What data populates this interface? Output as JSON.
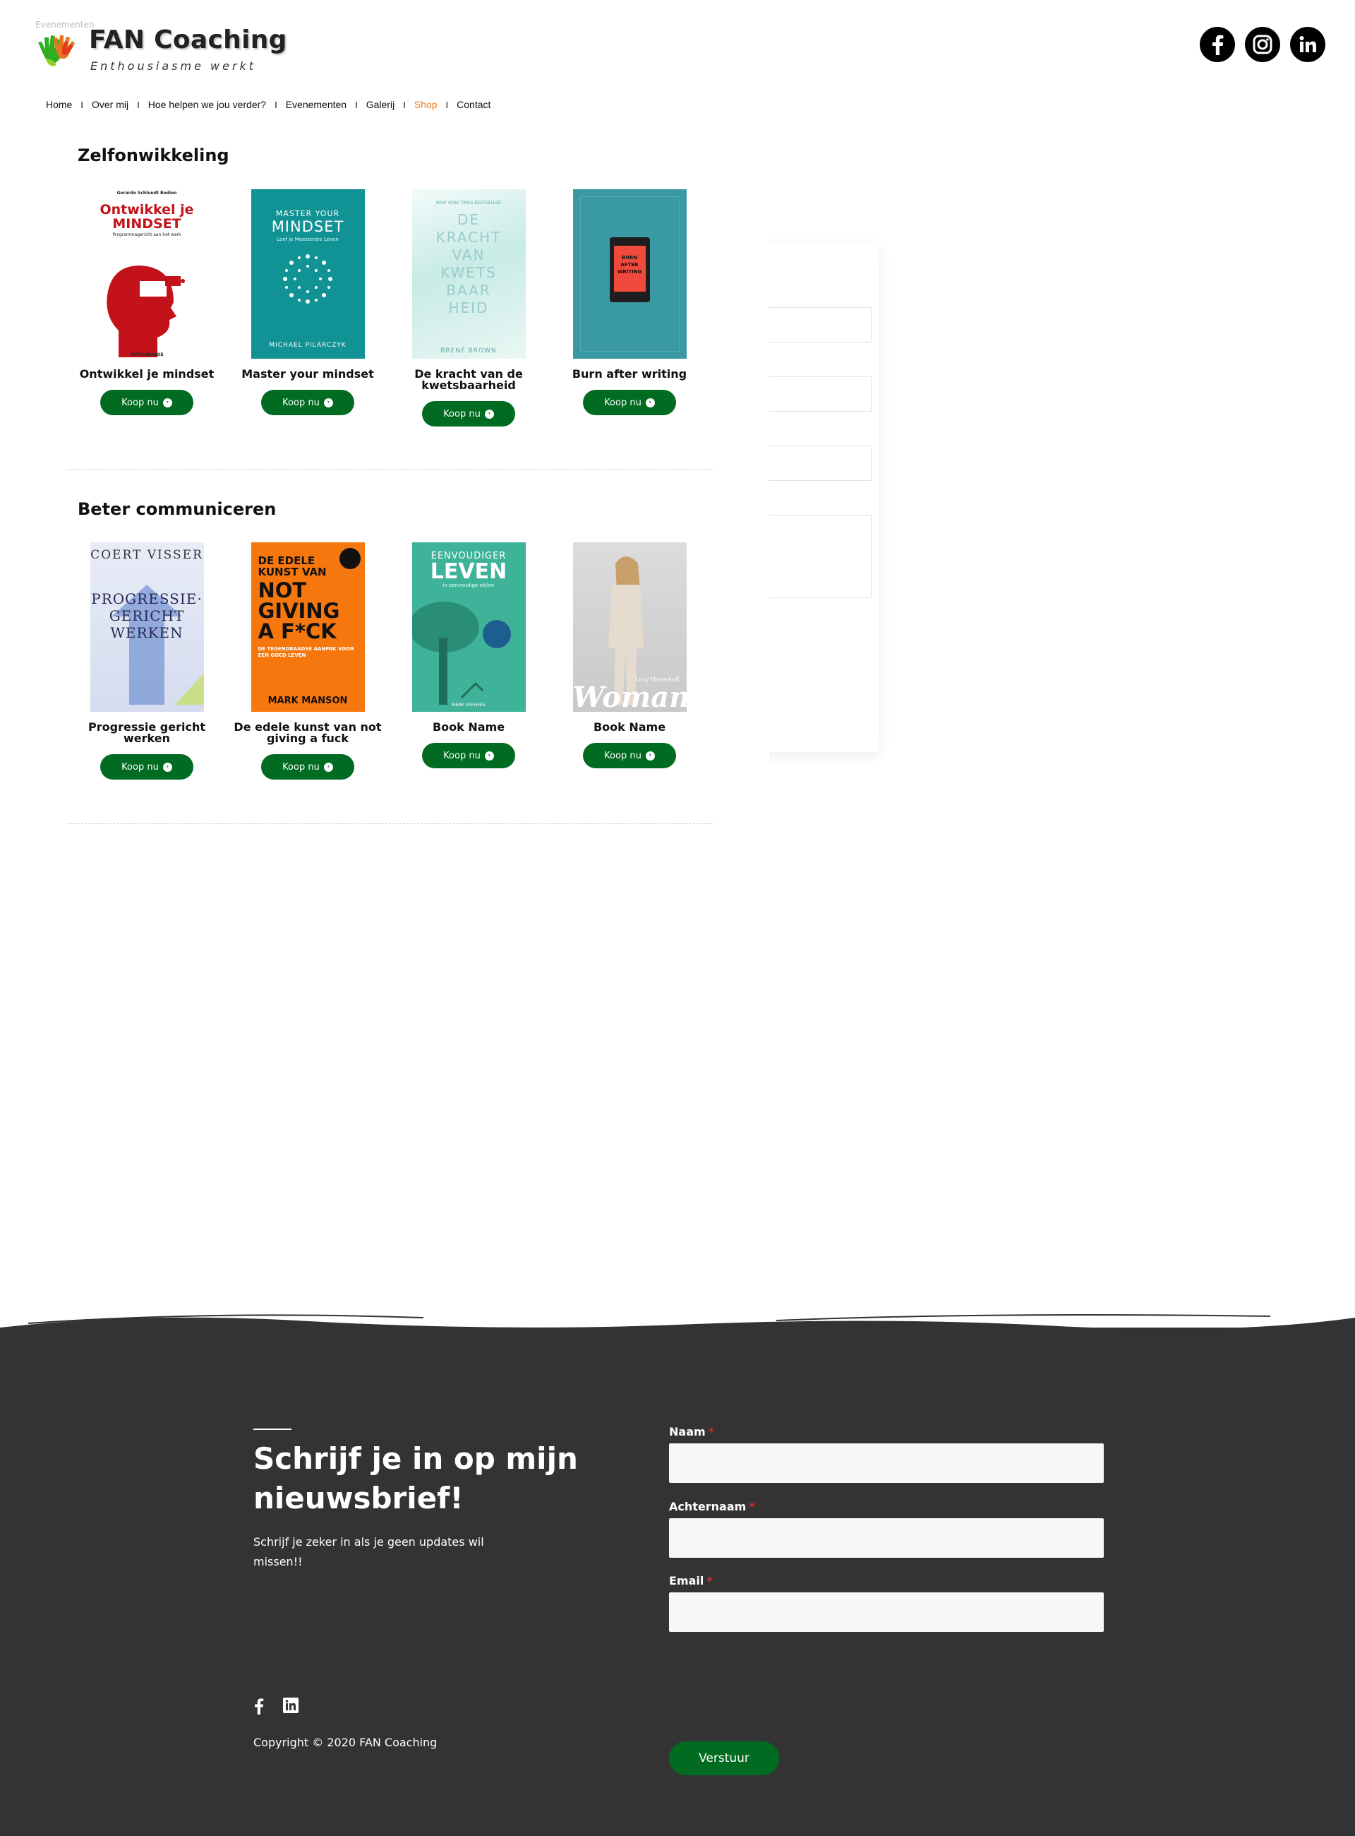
{
  "header": {
    "tiny_text": "Evenementen",
    "brand_title": "FAN Coaching",
    "tagline": "Enthousiasme werkt",
    "social": [
      "facebook-icon",
      "instagram-icon",
      "linkedin-icon"
    ]
  },
  "nav": {
    "items": [
      {
        "label": "Home"
      },
      {
        "label": "Over mij"
      },
      {
        "label": "Hoe helpen we jou verder?"
      },
      {
        "label": "Evenementen"
      },
      {
        "label": "Galerij"
      },
      {
        "label": "Shop"
      },
      {
        "label": "Contact"
      }
    ],
    "active": "Shop",
    "active_color": "#f07b1a"
  },
  "sections": [
    {
      "title": "Zelfonwikkeling",
      "books": [
        {
          "title": "Ontwikkel je mindset",
          "button": "Koop nu",
          "cover": {
            "top": "Gerardo Schlundt Bodien",
            "main": "Ontwikkel je MINDSET",
            "sub": "Programmagericht aan het werk",
            "bottom": "PSYCHOLOGIE"
          }
        },
        {
          "title": "Master your mindset",
          "button": "Koop nu",
          "cover": {
            "top": "MASTER YOUR",
            "main": "MINDSET",
            "sub": "Leef je Meesterste Leven",
            "bottom": "MICHAEL PILARCZYK"
          }
        },
        {
          "title": "De kracht van de kwetsbaarheid",
          "button": "Koop nu",
          "cover": {
            "top": "NEW YORK TIMES BESTSELLER",
            "main": "DE KRACHT VAN KWETS BAAR HEID",
            "sub": "",
            "bottom": "BRENÉ BROWN"
          }
        },
        {
          "title": "Burn after writing",
          "button": "Koop nu",
          "cover": {
            "top": "",
            "main": "BURN AFTER WRITING",
            "sub": "",
            "bottom": ""
          }
        }
      ]
    },
    {
      "title": "Beter communiceren",
      "books": [
        {
          "title": "Progressie gericht werken",
          "button": "Koop nu",
          "cover": {
            "top": "COERT VISSER",
            "main": "PROGRESSIE· GERICHT WERKEN",
            "sub": "",
            "bottom": ""
          }
        },
        {
          "title": "De edele kunst van not giving a fuck",
          "button": "Koop nu",
          "cover": {
            "top": "DE EDELE KUNST VAN",
            "main": "NOT GIVING A F*CK",
            "sub": "DE TEGENDRAADSE AANPAK VOOR EEN GOED LEVEN",
            "bottom": "MARK MANSON"
          }
        },
        {
          "title": "Book Name",
          "button": "Koop nu",
          "cover": {
            "top": "EENVOUDIGER",
            "main": "LEVEN",
            "sub": "in eenvoudige stijlen",
            "bottom": "MARK VERHEES"
          }
        },
        {
          "title": "Book Name",
          "button": "Koop nu",
          "cover": {
            "top": "Lucy Hoverhoff",
            "main": "Woman",
            "sub": "",
            "bottom": ""
          }
        }
      ]
    }
  ],
  "footer": {
    "heading": "Schrijf je in op mijn nieuwsbrief!",
    "description": "Schrijf je zeker in als je geen updates wil missen!!",
    "copyright": "Copyright © 2020 FAN Coaching",
    "form": {
      "fields": [
        {
          "label": "Naam",
          "required_mark": "*",
          "value": ""
        },
        {
          "label": "Achternaam",
          "required_mark": "*",
          "value": ""
        },
        {
          "label": "Email",
          "required_mark": "*",
          "value": ""
        }
      ],
      "submit_label": "Verstuur"
    },
    "social": [
      "facebook-icon",
      "linkedin-icon"
    ]
  },
  "colors": {
    "accent_green": "#006b21",
    "footer_bg": "#333333",
    "active_orange": "#f07b1a"
  }
}
